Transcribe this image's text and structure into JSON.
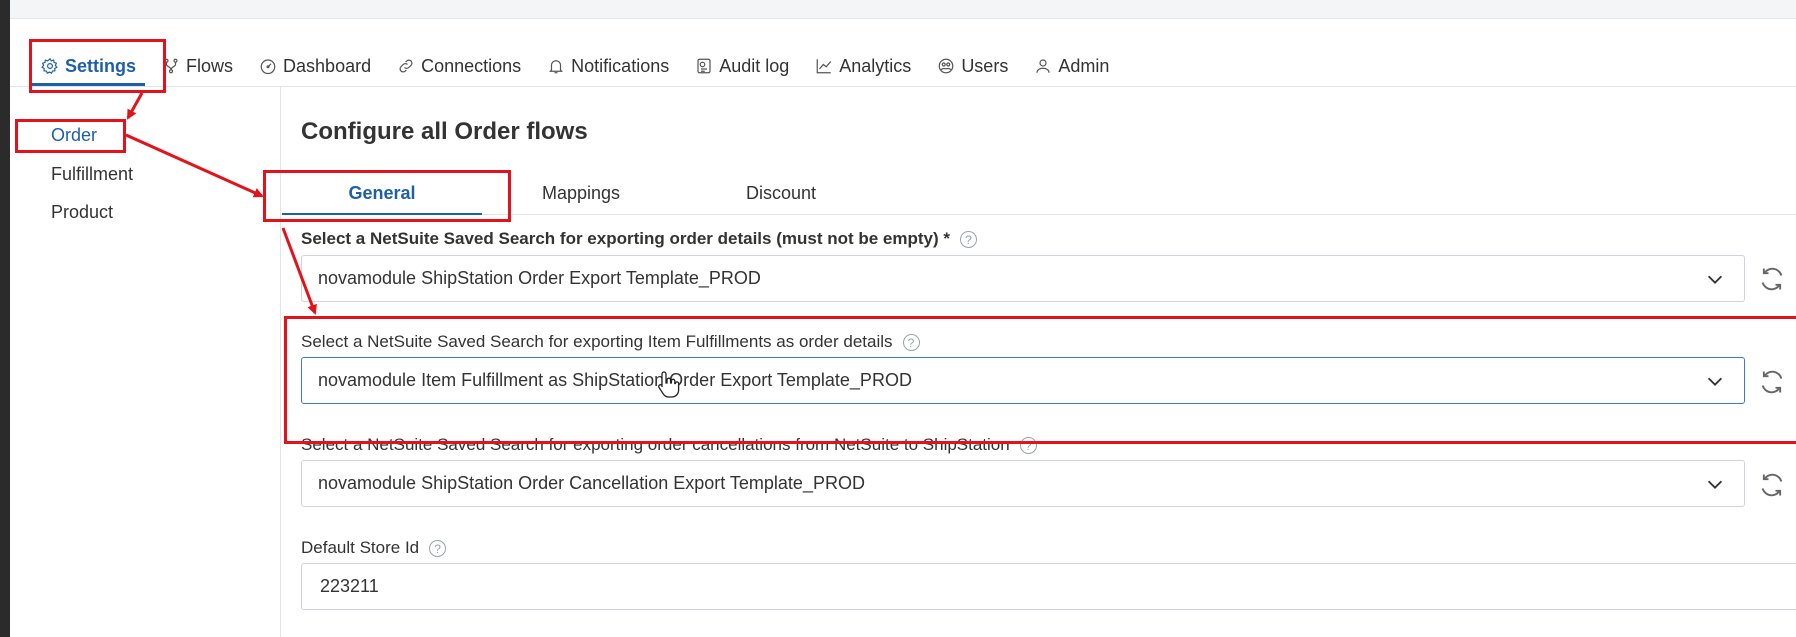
{
  "nav": {
    "items": [
      {
        "label": "Settings",
        "icon": "gear-icon",
        "active": true
      },
      {
        "label": "Flows",
        "icon": "flow-icon"
      },
      {
        "label": "Dashboard",
        "icon": "dashboard-icon"
      },
      {
        "label": "Connections",
        "icon": "link-icon"
      },
      {
        "label": "Notifications",
        "icon": "bell-icon"
      },
      {
        "label": "Audit log",
        "icon": "audit-log-icon"
      },
      {
        "label": "Analytics",
        "icon": "chart-icon"
      },
      {
        "label": "Users",
        "icon": "users-icon"
      },
      {
        "label": "Admin",
        "icon": "user-icon"
      }
    ]
  },
  "sidebar": {
    "items": [
      {
        "label": "Order",
        "active": true
      },
      {
        "label": "Fulfillment"
      },
      {
        "label": "Product"
      }
    ]
  },
  "main": {
    "title": "Configure all Order flows",
    "tabs": [
      {
        "label": "General",
        "active": true
      },
      {
        "label": "Mappings"
      },
      {
        "label": "Discount"
      }
    ],
    "fields": {
      "order_search": {
        "label": "Select a NetSuite Saved Search for exporting order details (must not be empty) *",
        "value": "novamodule ShipStation Order Export Template_PROD"
      },
      "fulfillment_search": {
        "label": "Select a NetSuite Saved Search for exporting Item Fulfillments as order details",
        "value": "novamodule Item Fulfillment as ShipStation Order Export Template_PROD"
      },
      "cancellation_search": {
        "label": "Select a NetSuite Saved Search for exporting order cancellations from NetSuite to ShipStation",
        "value": "novamodule ShipStation Order Cancellation Export Template_PROD"
      },
      "default_store": {
        "label": "Default Store Id",
        "value": "223211"
      }
    },
    "help_symbol": "?"
  },
  "colors": {
    "accent": "#1f5fa8",
    "annotation": "#e4121a",
    "focus_border": "#3b7ad1"
  }
}
